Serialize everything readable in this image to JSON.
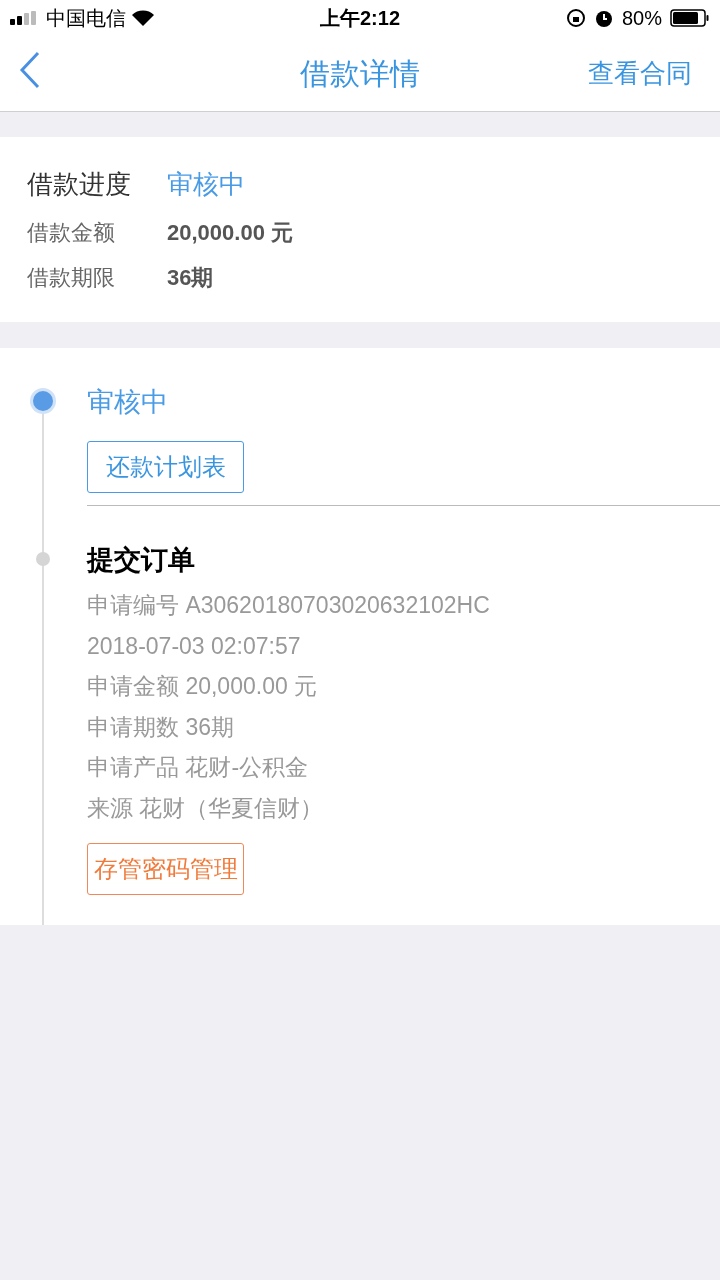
{
  "status_bar": {
    "carrier": "中国电信",
    "time": "上午2:12",
    "battery": "80%"
  },
  "nav": {
    "title": "借款详情",
    "action": "查看合同"
  },
  "summary": [
    {
      "kind": "status",
      "label": "借款进度",
      "value": "审核中"
    },
    {
      "kind": "plain",
      "label": "借款金额",
      "value": "20,000.00 元"
    },
    {
      "kind": "plain",
      "label": "借款期限",
      "value": "36期"
    }
  ],
  "timeline": [
    {
      "title": "审核中",
      "active": true,
      "button": {
        "kind": "primary",
        "label": "还款计划表"
      }
    },
    {
      "title": "提交订单",
      "active": false,
      "details": [
        "申请编号 A30620180703020632102HC",
        "2018-07-03 02:07:57",
        "申请金额 20,000.00 元",
        "申请期数 36期",
        "申请产品 花财-公积金",
        "来源 花财（华夏信财）"
      ],
      "button": {
        "kind": "warning",
        "label": "存管密码管理"
      }
    }
  ]
}
